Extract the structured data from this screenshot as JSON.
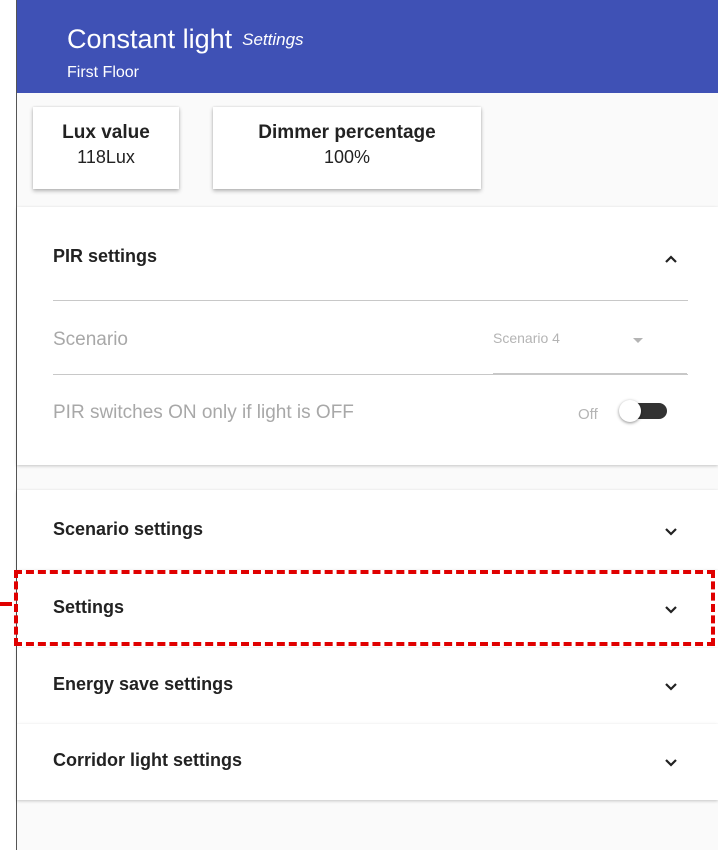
{
  "header": {
    "title": "Constant light",
    "title_suffix": "Settings",
    "subtitle": "First Floor",
    "color": "#3f51b5"
  },
  "metrics": [
    {
      "label": "Lux value",
      "value": "118Lux"
    },
    {
      "label": "Dimmer percentage",
      "value": "100%"
    }
  ],
  "pir_panel": {
    "title": "PIR settings",
    "expanded": true,
    "scenario_label": "Scenario",
    "scenario_value": "Scenario 4",
    "switch_label": "PIR switches ON only if light is OFF",
    "switch_state_label": "Off"
  },
  "panels": [
    {
      "title": "Scenario settings"
    },
    {
      "title": "Settings"
    },
    {
      "title": "Energy save settings"
    },
    {
      "title": "Corridor light settings"
    }
  ],
  "highlight_color": "#e00000"
}
